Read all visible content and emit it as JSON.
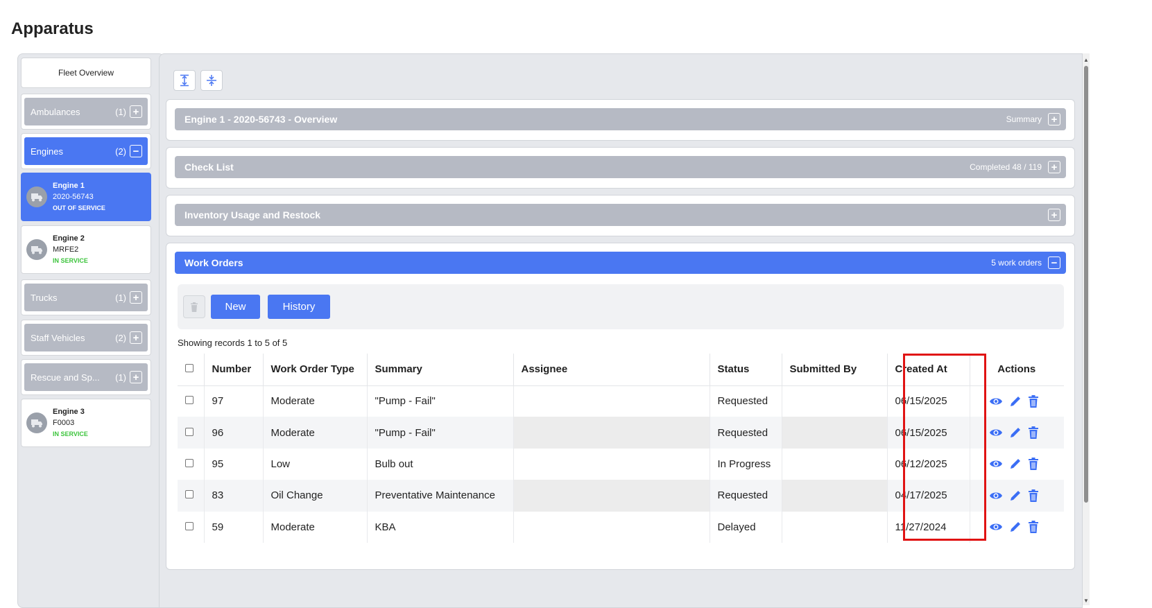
{
  "page": {
    "title": "Apparatus"
  },
  "sidebar": {
    "overview_label": "Fleet Overview",
    "groups": [
      {
        "label": "Ambulances",
        "count": "(1)",
        "toggle": "+"
      },
      {
        "label": "Engines",
        "count": "(2)",
        "toggle": "−"
      },
      {
        "label": "Trucks",
        "count": "(1)",
        "toggle": "+"
      },
      {
        "label": "Staff Vehicles",
        "count": "(2)",
        "toggle": "+"
      },
      {
        "label": "Rescue and Sp...",
        "count": "(1)",
        "toggle": "+"
      }
    ],
    "vehicles": [
      {
        "name": "Engine 1",
        "id": "2020-56743",
        "status": "OUT OF SERVICE"
      },
      {
        "name": "Engine 2",
        "id": "MRFE2",
        "status": "IN SERVICE"
      },
      {
        "name": "Engine 3",
        "id": "F0003",
        "status": "IN SERVICE"
      }
    ]
  },
  "sections": [
    {
      "title": "Engine 1 - 2020-56743 - Overview",
      "meta": "Summary",
      "toggle": "+"
    },
    {
      "title": "Check List",
      "meta": "Completed 48 / 119",
      "toggle": "+"
    },
    {
      "title": "Inventory Usage and Restock",
      "meta": "",
      "toggle": "+"
    },
    {
      "title": "Work Orders",
      "meta": "5 work orders",
      "toggle": "−"
    }
  ],
  "work_orders": {
    "new_label": "New",
    "history_label": "History",
    "records_text": "Showing records 1 to 5 of 5",
    "columns": [
      "Number",
      "Work Order Type",
      "Summary",
      "Assignee",
      "Status",
      "Submitted By",
      "Created At",
      "Actions"
    ],
    "rows": [
      {
        "number": "97",
        "type": "Moderate",
        "summary": "\"Pump - Fail\"",
        "status": "Requested",
        "created": "06/15/2025"
      },
      {
        "number": "96",
        "type": "Moderate",
        "summary": "\"Pump - Fail\"",
        "status": "Requested",
        "created": "06/15/2025"
      },
      {
        "number": "95",
        "type": "Low",
        "summary": "Bulb out",
        "status": "In Progress",
        "created": "06/12/2025"
      },
      {
        "number": "83",
        "type": "Oil Change",
        "summary": "Preventative Maintenance",
        "status": "Requested",
        "created": "04/17/2025"
      },
      {
        "number": "59",
        "type": "Moderate",
        "summary": "KBA",
        "status": "Delayed",
        "created": "11/27/2024"
      }
    ]
  },
  "colors": {
    "accent": "#4a77f2",
    "collapsed": "#b6bac4",
    "in_service": "#3cc43c",
    "highlight": "#e01313"
  }
}
